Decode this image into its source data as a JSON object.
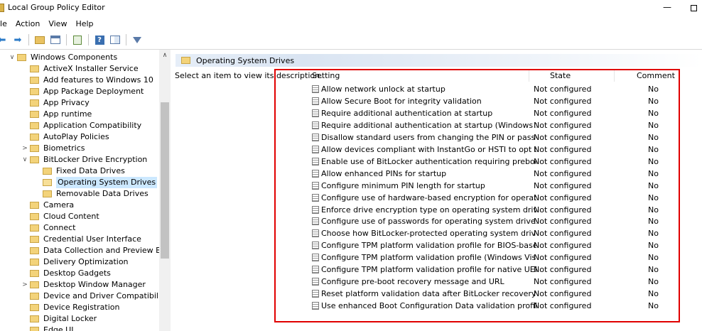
{
  "window": {
    "title": "Local Group Policy Editor",
    "minimize_glyph": "—"
  },
  "menu": [
    "ile",
    "Action",
    "View",
    "Help"
  ],
  "toolbar": {
    "icons": [
      "back-arrow-icon",
      "forward-arrow-icon",
      "up-folder-icon",
      "show-hide-tree-icon",
      "export-list-icon",
      "help-icon",
      "properties-icon",
      "filter-icon"
    ],
    "help_glyph": "?"
  },
  "tree": {
    "items": [
      {
        "label": "Windows Components",
        "expander": "∨",
        "indent": 0
      },
      {
        "label": "ActiveX Installer Service",
        "expander": "",
        "indent": 1
      },
      {
        "label": "Add features to Windows 10",
        "expander": "",
        "indent": 1
      },
      {
        "label": "App Package Deployment",
        "expander": "",
        "indent": 1
      },
      {
        "label": "App Privacy",
        "expander": "",
        "indent": 1
      },
      {
        "label": "App runtime",
        "expander": "",
        "indent": 1
      },
      {
        "label": "Application Compatibility",
        "expander": "",
        "indent": 1
      },
      {
        "label": "AutoPlay Policies",
        "expander": "",
        "indent": 1
      },
      {
        "label": "Biometrics",
        "expander": ">",
        "indent": 1
      },
      {
        "label": "BitLocker Drive Encryption",
        "expander": "∨",
        "indent": 1
      },
      {
        "label": "Fixed Data Drives",
        "expander": "",
        "indent": 2
      },
      {
        "label": "Operating System Drives",
        "expander": "",
        "indent": 2,
        "selected": true
      },
      {
        "label": "Removable Data Drives",
        "expander": "",
        "indent": 2
      },
      {
        "label": "Camera",
        "expander": "",
        "indent": 1
      },
      {
        "label": "Cloud Content",
        "expander": "",
        "indent": 1
      },
      {
        "label": "Connect",
        "expander": "",
        "indent": 1
      },
      {
        "label": "Credential User Interface",
        "expander": "",
        "indent": 1
      },
      {
        "label": "Data Collection and Preview Bui",
        "expander": "",
        "indent": 1
      },
      {
        "label": "Delivery Optimization",
        "expander": "",
        "indent": 1
      },
      {
        "label": "Desktop Gadgets",
        "expander": "",
        "indent": 1
      },
      {
        "label": "Desktop Window Manager",
        "expander": ">",
        "indent": 1
      },
      {
        "label": "Device and Driver Compatibility",
        "expander": "",
        "indent": 1
      },
      {
        "label": "Device Registration",
        "expander": "",
        "indent": 1
      },
      {
        "label": "Digital Locker",
        "expander": "",
        "indent": 1
      },
      {
        "label": "Edge UI",
        "expander": "",
        "indent": 1
      }
    ],
    "scroll_up_glyph": "∧"
  },
  "right": {
    "header_title": "Operating System Drives",
    "description": "Select an item to view its description.",
    "columns": {
      "setting": "Setting",
      "state": "State",
      "comment": "Comment"
    },
    "rows": [
      {
        "setting": "Allow network unlock at startup",
        "state": "Not configured",
        "comment": "No"
      },
      {
        "setting": "Allow Secure Boot for integrity validation",
        "state": "Not configured",
        "comment": "No"
      },
      {
        "setting": "Require additional authentication at startup",
        "state": "Not configured",
        "comment": "No"
      },
      {
        "setting": "Require additional authentication at startup (Windows Serve...",
        "state": "Not configured",
        "comment": "No"
      },
      {
        "setting": "Disallow standard users from changing the PIN or password",
        "state": "Not configured",
        "comment": "No"
      },
      {
        "setting": "Allow devices compliant with InstantGo or HSTI to opt out o...",
        "state": "Not configured",
        "comment": "No"
      },
      {
        "setting": "Enable use of BitLocker authentication requiring preboot ke...",
        "state": "Not configured",
        "comment": "No"
      },
      {
        "setting": "Allow enhanced PINs for startup",
        "state": "Not configured",
        "comment": "No"
      },
      {
        "setting": "Configure minimum PIN length for startup",
        "state": "Not configured",
        "comment": "No"
      },
      {
        "setting": "Configure use of hardware-based encryption for operating s...",
        "state": "Not configured",
        "comment": "No"
      },
      {
        "setting": "Enforce drive encryption type on operating system drives",
        "state": "Not configured",
        "comment": "No"
      },
      {
        "setting": "Configure use of passwords for operating system drives",
        "state": "Not configured",
        "comment": "No"
      },
      {
        "setting": "Choose how BitLocker-protected operating system drives ca...",
        "state": "Not configured",
        "comment": "No"
      },
      {
        "setting": "Configure TPM platform validation profile for BIOS-based fir...",
        "state": "Not configured",
        "comment": "No"
      },
      {
        "setting": "Configure TPM platform validation profile (Windows Vista, ...",
        "state": "Not configured",
        "comment": "No"
      },
      {
        "setting": "Configure TPM platform validation profile for native UEFI fir...",
        "state": "Not configured",
        "comment": "No"
      },
      {
        "setting": "Configure pre-boot recovery message and URL",
        "state": "Not configured",
        "comment": "No"
      },
      {
        "setting": "Reset platform validation data after BitLocker recovery",
        "state": "Not configured",
        "comment": "No"
      },
      {
        "setting": "Use enhanced Boot Configuration Data validation profile",
        "state": "Not configured",
        "comment": "No"
      }
    ]
  },
  "colors": {
    "highlight": "#e00000",
    "selection": "#cce8ff",
    "folder": "#f3d37a"
  }
}
